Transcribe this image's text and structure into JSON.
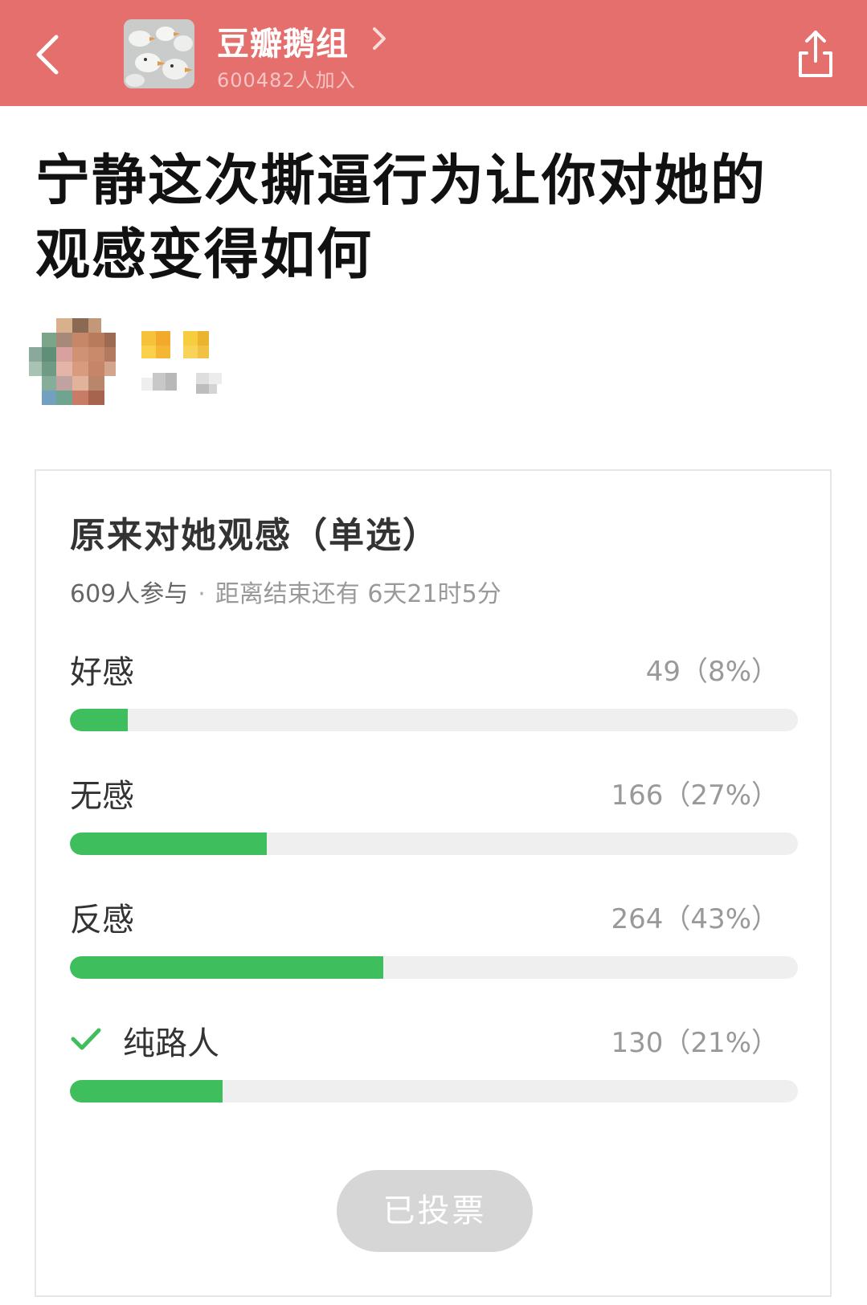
{
  "header": {
    "group_name": "豆瓣鹅组",
    "members": "600482人加入",
    "accent_color": "#e46f6c",
    "icons": {
      "back": "chevron-left-icon",
      "more": "chevron-right-icon",
      "share": "share-icon"
    }
  },
  "post": {
    "title": "宁静这次撕逼行为让你对她的观感变得如何"
  },
  "poll": {
    "title": "原来对她观感（单选）",
    "participants": "609人参与",
    "separator": "·",
    "deadline": "距离结束还有 6天21时5分",
    "bar_color": "#3fbe5d",
    "options": [
      {
        "label": "好感",
        "count": "49（8%）",
        "percent": 8,
        "selected": false
      },
      {
        "label": "无感",
        "count": "166（27%）",
        "percent": 27,
        "selected": false
      },
      {
        "label": "反感",
        "count": "264（43%）",
        "percent": 43,
        "selected": false
      },
      {
        "label": "纯路人",
        "count": "130（21%）",
        "percent": 21,
        "selected": true
      }
    ],
    "voted_label": "已投票"
  }
}
